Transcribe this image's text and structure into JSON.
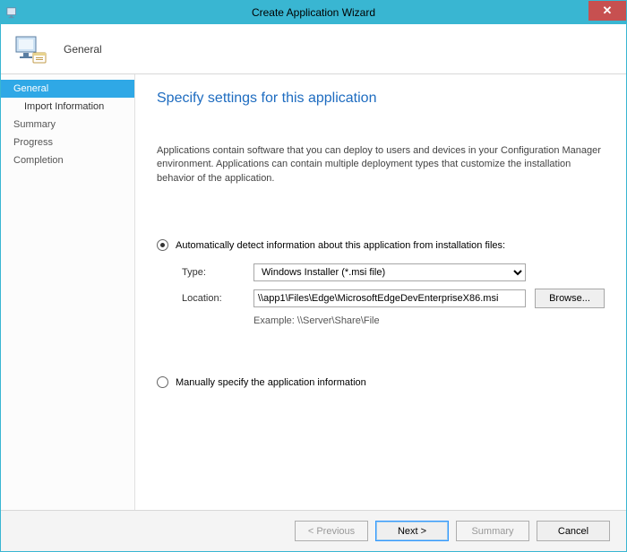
{
  "titlebar": {
    "title": "Create Application Wizard",
    "close": "✕"
  },
  "header": {
    "title": "General"
  },
  "sidebar": {
    "items": [
      {
        "label": "General",
        "selected": true,
        "sub": false
      },
      {
        "label": "Import Information",
        "selected": false,
        "sub": true
      },
      {
        "label": "Summary",
        "selected": false,
        "sub": false
      },
      {
        "label": "Progress",
        "selected": false,
        "sub": false
      },
      {
        "label": "Completion",
        "selected": false,
        "sub": false
      }
    ]
  },
  "content": {
    "heading": "Specify settings for this application",
    "description": "Applications contain software that you can deploy to users and devices in your Configuration Manager environment. Applications can contain multiple deployment types that customize the installation behavior of the application.",
    "radio_auto": "Automatically detect information about this application from installation files:",
    "type_label": "Type:",
    "type_value": "Windows Installer (*.msi file)",
    "location_label": "Location:",
    "location_value": "\\\\app1\\Files\\Edge\\MicrosoftEdgeDevEnterpriseX86.msi",
    "browse": "Browse...",
    "example": "Example: \\\\Server\\Share\\File",
    "radio_manual": "Manually specify the application information"
  },
  "footer": {
    "previous": "< Previous",
    "next": "Next >",
    "summary": "Summary",
    "cancel": "Cancel"
  }
}
